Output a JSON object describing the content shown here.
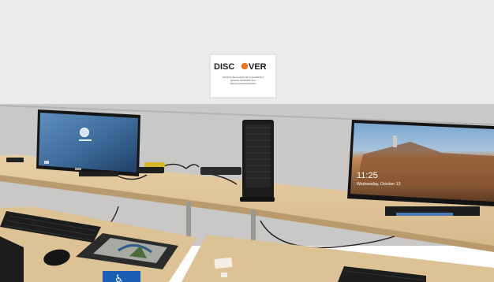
{
  "sign": {
    "brand_left": "DISC",
    "brand_right": "VER",
    "line1": "Access to this computer lab is provided by a",
    "line2": "generous contribution from",
    "line3": "Discover Financial Services"
  },
  "lock_screen": {
    "time": "11:25",
    "date": "Wednesday, October 13"
  },
  "colors": {
    "wall": "#ecebe9",
    "lower_wall": "#c9c8c6",
    "desk": "#e2c79d",
    "accessibility_blue": "#1a5fb4",
    "discover_orange": "#f2731f"
  },
  "icons": [
    "accessibility-icon"
  ]
}
